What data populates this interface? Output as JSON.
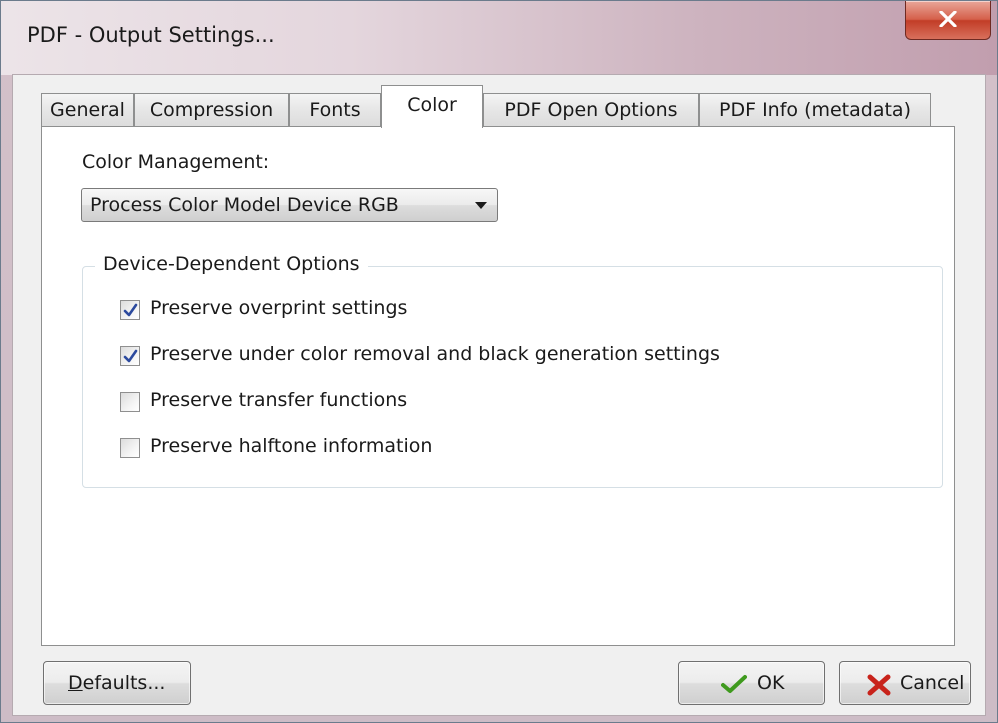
{
  "window": {
    "title": "PDF - Output Settings..."
  },
  "tabs": [
    {
      "label": "General",
      "active": false
    },
    {
      "label": "Compression",
      "active": false
    },
    {
      "label": "Fonts",
      "active": false
    },
    {
      "label": "Color",
      "active": true
    },
    {
      "label": "PDF Open Options",
      "active": false
    },
    {
      "label": "PDF Info (metadata)",
      "active": false
    }
  ],
  "color_panel": {
    "color_management_label": "Color Management:",
    "color_management_value": "Process Color Model Device RGB",
    "group_title": "Device-Dependent Options",
    "options": [
      {
        "label": "Preserve overprint settings",
        "checked": true
      },
      {
        "label": "Preserve under color removal and black generation settings",
        "checked": true
      },
      {
        "label": "Preserve transfer functions",
        "checked": false
      },
      {
        "label": "Preserve halftone information",
        "checked": false
      }
    ]
  },
  "buttons": {
    "defaults": "Defaults...",
    "ok": "OK",
    "cancel": "Cancel"
  },
  "colors": {
    "ok_check": "#3f9a1e",
    "cancel_x": "#c8231b",
    "checkmark": "#2c4a9e",
    "close_button": "#c94a35"
  },
  "icons": {
    "close": "close-icon",
    "dropdown": "chevron-down-icon",
    "ok": "checkmark-icon",
    "cancel": "x-icon"
  }
}
